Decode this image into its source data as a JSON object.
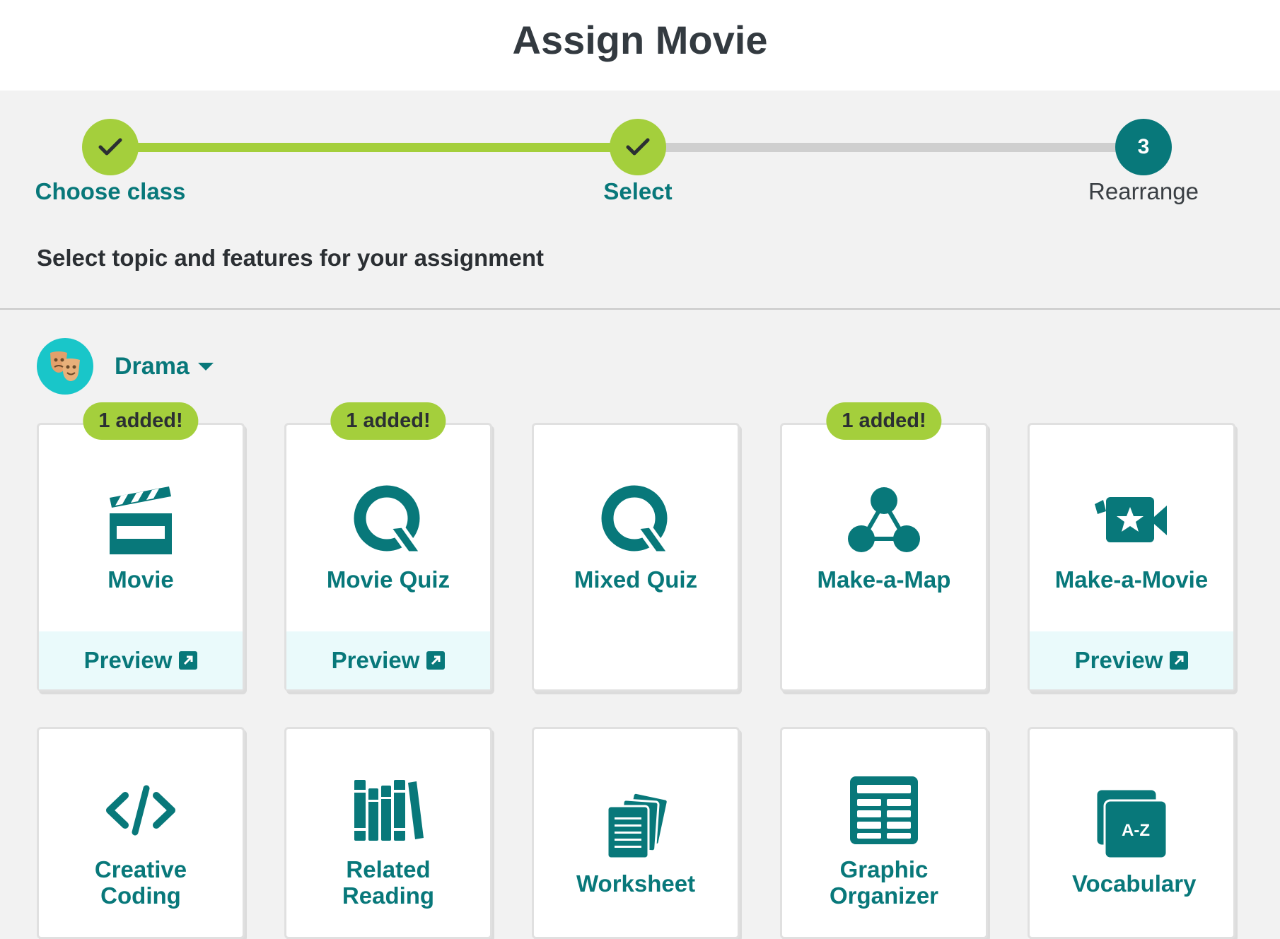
{
  "header": {
    "title": "Assign Movie"
  },
  "stepper": {
    "steps": [
      {
        "label": "Choose class",
        "state": "done"
      },
      {
        "label": "Select",
        "state": "done"
      },
      {
        "label": "Rearrange",
        "state": "current",
        "number": "3"
      }
    ]
  },
  "subtitle": "Select topic and features for your assignment",
  "topic": {
    "name": "Drama",
    "icon": "drama-masks-icon"
  },
  "features": [
    {
      "title": "Movie",
      "icon": "clapperboard-icon",
      "badge": "1 added!",
      "preview": "Preview"
    },
    {
      "title": "Movie Quiz",
      "icon": "quiz-q-icon",
      "badge": "1 added!",
      "preview": "Preview"
    },
    {
      "title": "Mixed Quiz",
      "icon": "quiz-q-icon"
    },
    {
      "title": "Make-a-Map",
      "icon": "map-nodes-icon",
      "badge": "1 added!"
    },
    {
      "title": "Make-a-Movie",
      "icon": "video-camera-star-icon",
      "preview": "Preview"
    },
    {
      "title": "Creative Coding",
      "icon": "code-icon"
    },
    {
      "title": "Related Reading",
      "icon": "books-icon"
    },
    {
      "title": "Worksheet",
      "icon": "worksheet-pages-icon"
    },
    {
      "title": "Graphic Organizer",
      "icon": "table-grid-icon"
    },
    {
      "title": "Vocabulary",
      "icon": "vocabulary-cards-icon",
      "icon_text": "A-Z"
    }
  ],
  "colors": {
    "teal": "#08787a",
    "green": "#a4cf3c",
    "gray_track": "#cfcfcf"
  }
}
